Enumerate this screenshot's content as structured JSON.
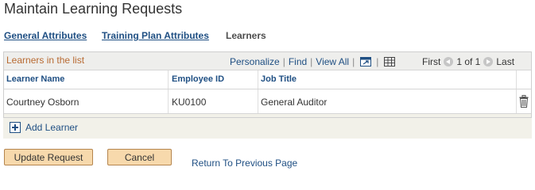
{
  "page": {
    "title": "Maintain Learning Requests",
    "tabs": [
      {
        "label": "General Attributes"
      },
      {
        "label": "Training Plan Attributes"
      },
      {
        "label": "Learners"
      }
    ]
  },
  "grid": {
    "title": "Learners in the list",
    "tools": {
      "personalize": "Personalize",
      "find": "Find",
      "view_all": "View All"
    },
    "nav": {
      "first": "First",
      "range": "1 of 1",
      "last": "Last"
    },
    "columns": [
      "Learner Name",
      "Employee ID",
      "Job Title"
    ],
    "rows": [
      {
        "learner_name": "Courtney Osborn",
        "employee_id": "KU0100",
        "job_title": "General Auditor"
      }
    ],
    "add_label": "Add Learner"
  },
  "actions": {
    "update": "Update Request",
    "cancel": "Cancel",
    "return": "Return To Previous Page"
  },
  "icons": {
    "zoom": "zoom-icon",
    "download": "download-to-spreadsheet-icon",
    "prev": "previous-page-icon",
    "next": "next-page-icon",
    "delete": "trash-icon",
    "add": "plus-icon"
  },
  "colors": {
    "link": "#1f4f83",
    "grid_title": "#b86a32",
    "button_bg": "#f7d9ac",
    "grid_bg": "#f2f1e9"
  }
}
